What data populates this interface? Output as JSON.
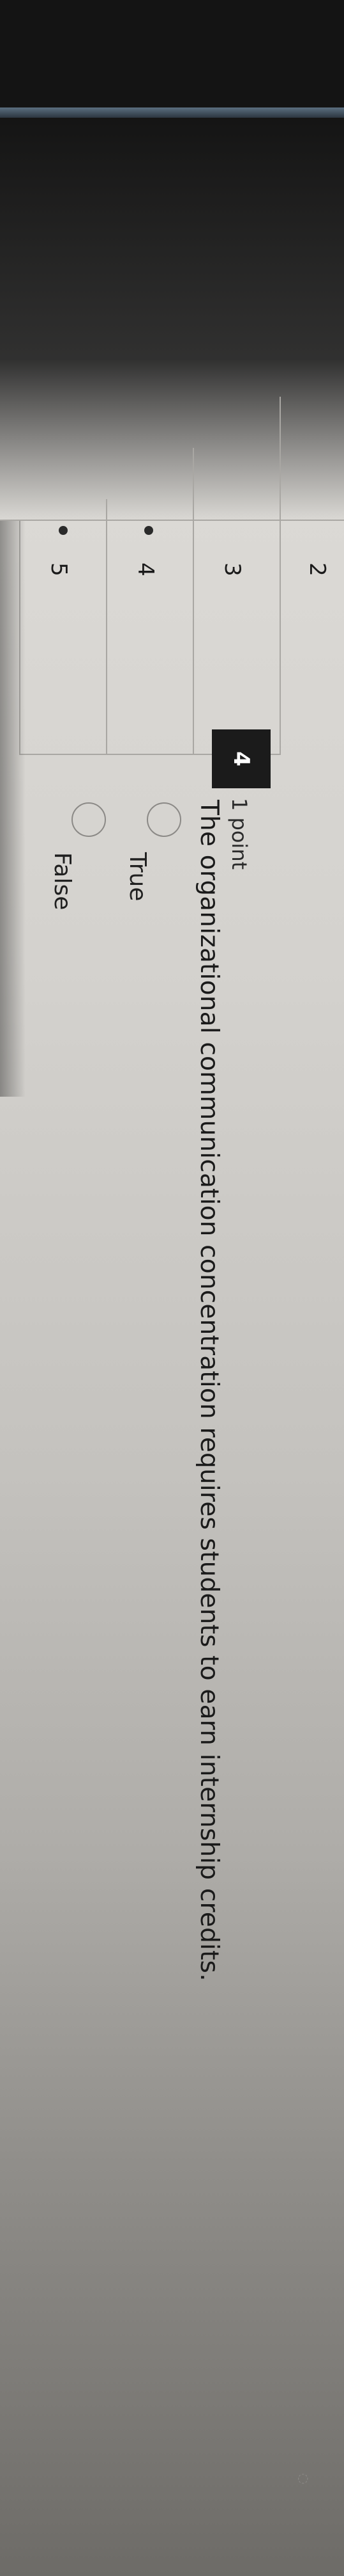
{
  "navigator": {
    "items": [
      {
        "label": "2"
      },
      {
        "label": "3"
      },
      {
        "label": "4"
      },
      {
        "label": "5"
      }
    ]
  },
  "question": {
    "number": "4",
    "points": "1 point",
    "text": "The organizational communication concentration requires students to earn internship credits.",
    "options": [
      {
        "label": "True",
        "selected": false
      },
      {
        "label": "False",
        "selected": false
      }
    ]
  }
}
